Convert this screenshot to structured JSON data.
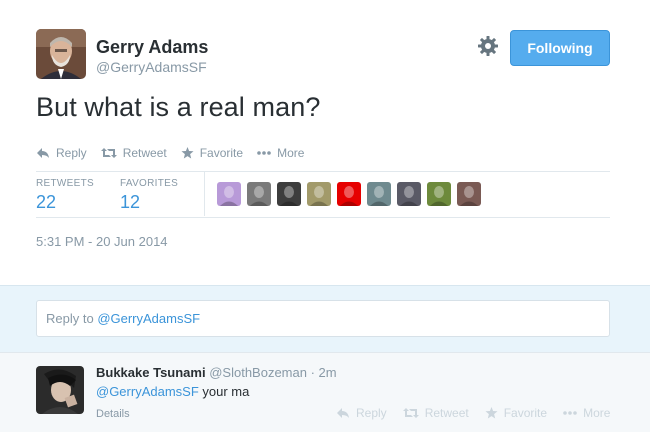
{
  "tweet": {
    "author_name": "Gerry Adams",
    "author_handle": "@GerryAdamsSF",
    "follow_label": "Following",
    "text": "But what is a real man?",
    "actions": {
      "reply": "Reply",
      "retweet": "Retweet",
      "favorite": "Favorite",
      "more": "More"
    },
    "stats": {
      "retweets_label": "RETWEETS",
      "retweets_value": "22",
      "favorites_label": "FAVORITES",
      "favorites_value": "12"
    },
    "favoriter_avatar_colors": [
      "#b89ad8",
      "#7a7a7a",
      "#3d3d3d",
      "#a29a6a",
      "#e60000",
      "#6f8a8f",
      "#5a5a66",
      "#6d8a3c",
      "#7a5a54"
    ],
    "timestamp": "5:31 PM - 20 Jun 2014"
  },
  "reply_box": {
    "prefix": "Reply to ",
    "mention": "@GerryAdamsSF"
  },
  "reply": {
    "author_name": "Bukkake Tsunami",
    "author_handle": "@SlothBozeman",
    "separator": " · ",
    "time": "2m",
    "mention": "@GerryAdamsSF",
    "text": " your ma",
    "details": "Details",
    "actions": {
      "reply": "Reply",
      "retweet": "Retweet",
      "favorite": "Favorite",
      "more": "More"
    }
  },
  "colors": {
    "accent": "#55acee",
    "link": "#3b94d9",
    "muted": "#8899a6",
    "reply_bg": "#e8f4fb"
  }
}
